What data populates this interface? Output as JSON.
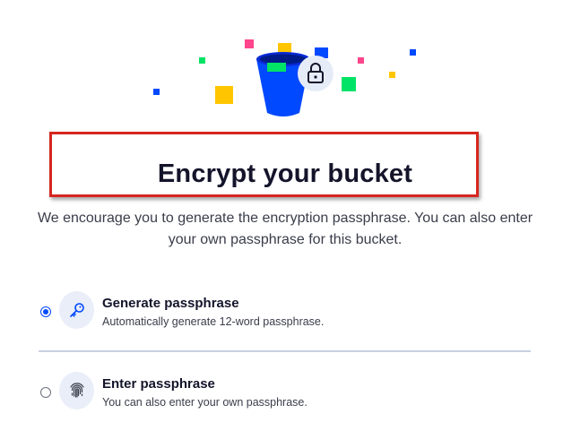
{
  "header": {
    "title": "Encrypt your bucket",
    "description": "We encourage you to generate the encryption passphrase. You can also enter your own passphrase for this bucket."
  },
  "options": [
    {
      "title": "Generate passphrase",
      "subtitle": "Automatically generate 12-word passphrase.",
      "icon": "key-icon",
      "selected": true
    },
    {
      "title": "Enter passphrase",
      "subtitle": "You can also enter your own passphrase.",
      "icon": "fingerprint-icon",
      "selected": false
    }
  ],
  "colors": {
    "accent": "#0149ff",
    "highlight_border": "#d6261f",
    "title_text": "#14142b",
    "icon_bg": "#e9eef8",
    "bucket": "#0149ff"
  },
  "illustration": {
    "icons": [
      "bucket-icon",
      "padlock-icon",
      "confetti-squares"
    ]
  }
}
